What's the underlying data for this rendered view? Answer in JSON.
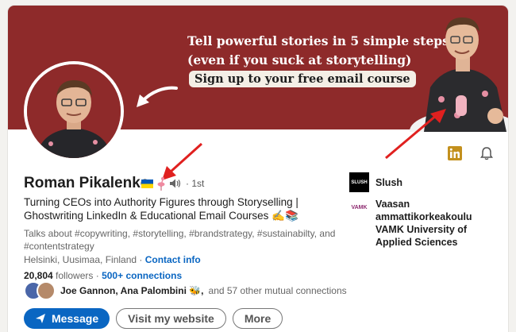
{
  "banner": {
    "line1": "Tell powerful stories in 5 simple steps",
    "line2": "(even if you suck at storytelling)",
    "cta": "Sign up to your free email course"
  },
  "profile": {
    "name": "Roman Pikalenko",
    "degree": "· 1st",
    "headline": "Turning CEOs into Authority Figures through Storyselling | Ghostwriting LinkedIn & Educational Email Courses ✍️📚",
    "about": "Talks about #copywriting, #storytelling, #brandstrategy, #sustainabilty, and #contentstrategy",
    "location": "Helsinki, Uusimaa, Finland ·",
    "contact_info": "Contact info",
    "followers_count": "20,804",
    "followers_label": "followers ·",
    "connections": "500+ connections",
    "mutual_names": "Joe Gannon, Ana Palombini 🐝,",
    "mutual_rest": "and 57 other mutual connections"
  },
  "buttons": {
    "message": "Message",
    "website": "Visit my website",
    "more": "More"
  },
  "orgs": [
    {
      "logo_text": "SLUSH",
      "name": "Slush"
    },
    {
      "logo_text": "VAMK",
      "name": "Vaasan ammattikorkeakoulu VAMK University of Applied Sciences"
    }
  ],
  "colors": {
    "banner": "#8e2a2a",
    "primary": "#0a66c2",
    "arrow": "#e0201f",
    "linkedin_gold": "#c3901d"
  },
  "icons": [
    "linkedin-icon",
    "bell-icon",
    "send-icon",
    "ukraine-flag-icon",
    "flamingo-icon",
    "speaker-icon"
  ]
}
